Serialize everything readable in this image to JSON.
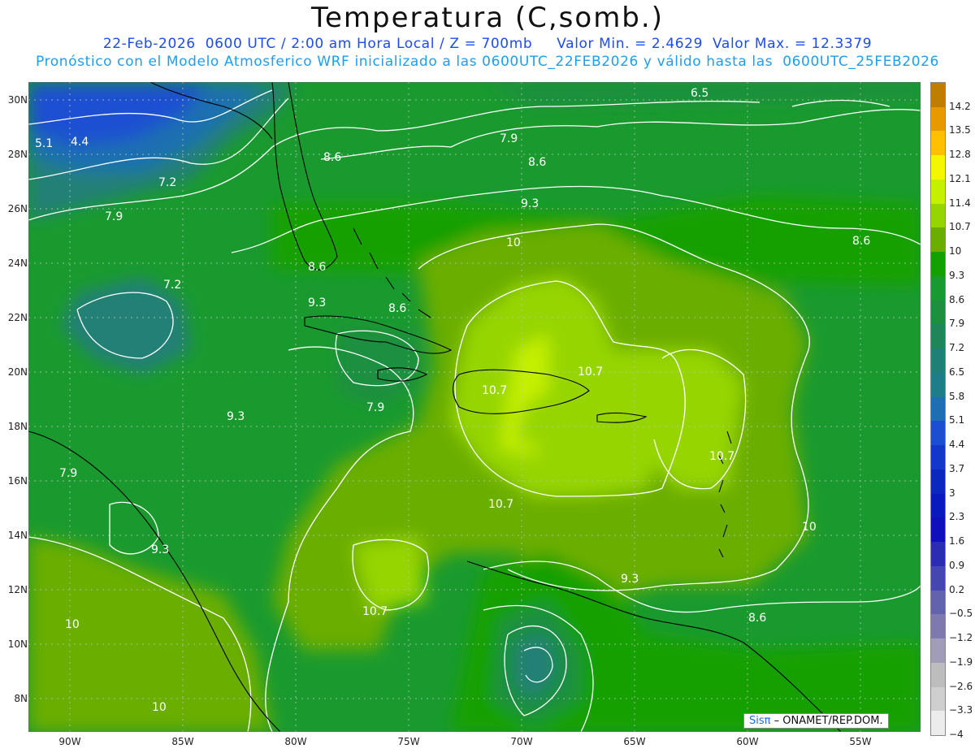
{
  "header": {
    "title": "Temperatura (C,somb.)",
    "line1": "22-Feb-2026  0600 UTC / 2:00 am Hora Local / Z = 700mb     Valor Min. = 2.4629  Valor Max. = 12.3379",
    "line2": "Pronóstico con el Modelo Atmosferico WRF inicializado a las 0600UTC_22FEB2026 y válido hasta las  0600UTC_25FEB2026"
  },
  "map": {
    "y_axis_labels": [
      "30N",
      "28N",
      "26N",
      "24N",
      "22N",
      "20N",
      "18N",
      "16N",
      "14N",
      "12N",
      "10N",
      "8N"
    ],
    "x_axis_labels": [
      "90W",
      "85W",
      "80W",
      "75W",
      "70W",
      "65W",
      "60W",
      "55W"
    ],
    "contour_labels": [
      "6.5",
      "5.1",
      "4.4",
      "8.6",
      "7.9",
      "8.6",
      "7.2",
      "9.3",
      "7.9",
      "10",
      "8.6",
      "8.6",
      "7.2",
      "9.3",
      "8.6",
      "10.7",
      "10.7",
      "7.9",
      "9.3",
      "10.7",
      "7.9",
      "10.7",
      "10",
      "9.3",
      "10.7",
      "9.3",
      "10",
      "8.6",
      "10",
      "10"
    ],
    "contour_color": "#ffffff",
    "coast_color": "#000000"
  },
  "legend": {
    "labels": [
      "14.2",
      "13.5",
      "12.8",
      "12.1",
      "11.4",
      "10.7",
      "10",
      "9.3",
      "8.6",
      "7.9",
      "7.2",
      "6.5",
      "5.8",
      "5.1",
      "4.4",
      "3.7",
      "3",
      "2.3",
      "1.6",
      "0.9",
      "0.2",
      "−0.5",
      "−1.2",
      "−1.9",
      "−2.6",
      "−3.3",
      "−4"
    ],
    "colors": [
      "#c07e00",
      "#e69a00",
      "#ffc000",
      "#f4f700",
      "#c5f000",
      "#96d500",
      "#6aae00",
      "#14a000",
      "#1a9a2e",
      "#1f8f3f",
      "#21855a",
      "#208077",
      "#1f7d8a",
      "#1e6fb1",
      "#1a4fd1",
      "#1238c9",
      "#0a28c0",
      "#0819bd",
      "#0f0fbd",
      "#2b2bb4",
      "#4646b0",
      "#6262ae",
      "#7e7ab0",
      "#a19cb8",
      "#bdbdbd",
      "#cfcfcf",
      "#ececec"
    ]
  },
  "credit": {
    "brand": "Sisπ",
    "text": "– ONAMET/REP.DOM."
  }
}
